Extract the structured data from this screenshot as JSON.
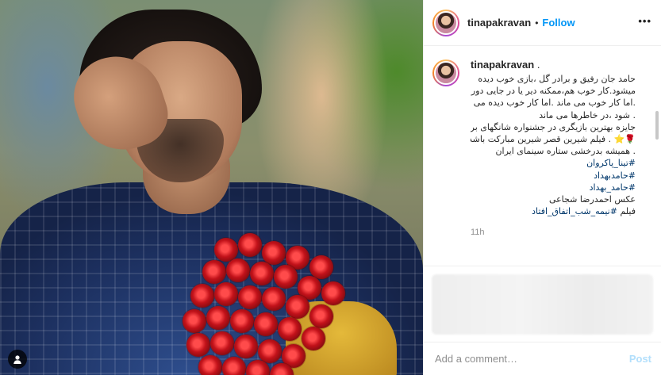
{
  "post": {
    "username": "tinapakravan",
    "dot": "•",
    "follow_label": "Follow",
    "more_label": "•••"
  },
  "caption": {
    "username": "tinapakravan",
    "username_trail": " .",
    "lines": [
      "حامد جان رفیق و برادر گل ،بازی خوب دیده",
      "میشود.کار خوب هم،ممکنه دیر یا در جایی دور",
      ".اما کار خوب می ماند .اما کار خوب دیده می",
      ". شود ،در خاطرها می ماند",
      "جایزه بهترین بازیگری در جشنواره شانگهای برای",
      "🌹⭐ . فیلم شیرین قصر شیرین مبارکت باشد",
      ". همیشه بدرخشی ستاره سینمای ایران"
    ],
    "hashtags": [
      "#تینا_پاکروان",
      "#حامدبهداد",
      "#حامد_بهداد"
    ],
    "photo_credit": "عکس احمدرضا شجاعی",
    "film_line_prefix": "فیلم ",
    "film_hashtag": "#نیمه_شب_اتفاق_افتاد",
    "time": "11h"
  },
  "comment_input": {
    "placeholder": "Add a comment…",
    "post_label": "Post"
  },
  "colors": {
    "link_blue": "#0095f6",
    "hashtag": "#00376b",
    "post_disabled": "#b2dffc",
    "muted": "#8e8e8e"
  }
}
